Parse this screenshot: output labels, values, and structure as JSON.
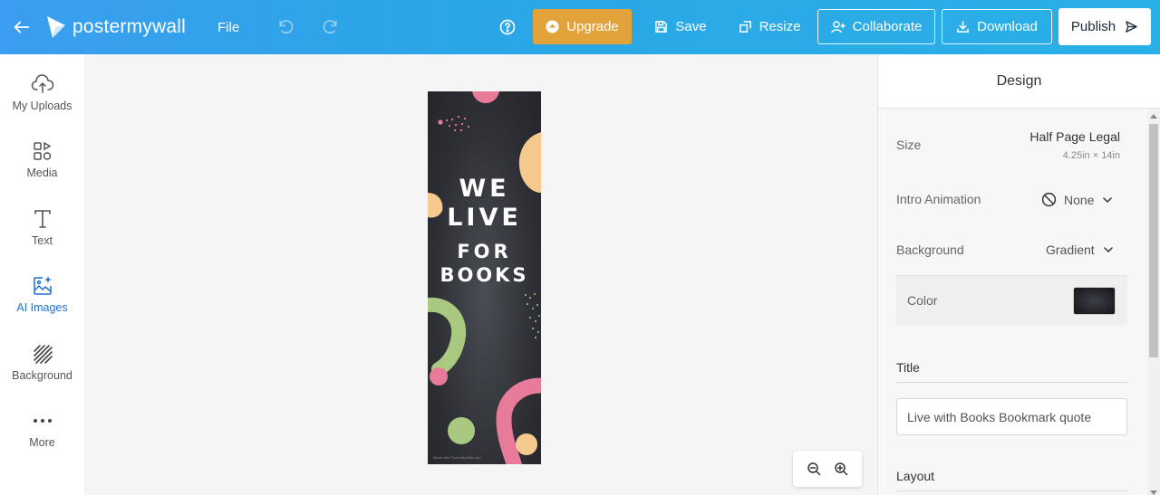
{
  "app": {
    "brand": "postermywall"
  },
  "toolbar": {
    "file_label": "File",
    "upgrade_label": "Upgrade",
    "save_label": "Save",
    "resize_label": "Resize",
    "collaborate_label": "Collaborate",
    "download_label": "Download",
    "publish_label": "Publish"
  },
  "sidebar": {
    "items": [
      {
        "label": "My Uploads",
        "icon": "upload-cloud-icon"
      },
      {
        "label": "Media",
        "icon": "media-icon"
      },
      {
        "label": "Text",
        "icon": "text-icon"
      },
      {
        "label": "AI Images",
        "icon": "ai-image-icon",
        "active": true
      },
      {
        "label": "Background",
        "icon": "background-icon"
      },
      {
        "label": "More",
        "icon": "more-icon"
      }
    ]
  },
  "poster": {
    "line1": "WE",
    "line2": "LIVE",
    "line3": "FOR",
    "line4": "BOOKS",
    "watermark": "Made with PosterMyWall.com"
  },
  "panel": {
    "heading": "Design",
    "size_label": "Size",
    "size_value": "Half Page Legal",
    "size_dimensions": "4.25in × 14in",
    "intro_animation_label": "Intro Animation",
    "intro_animation_value": "None",
    "background_label": "Background",
    "background_value": "Gradient",
    "color_label": "Color",
    "title_heading": "Title",
    "title_value": "Live with Books Bookmark quote",
    "layout_heading": "Layout"
  },
  "colors": {
    "topbar_start": "#3b9ef0",
    "topbar_end": "#2ab0e8",
    "upgrade": "#e2a33a",
    "active_sidebar": "#1f6fd1",
    "poster_bg": "#2e3036"
  }
}
